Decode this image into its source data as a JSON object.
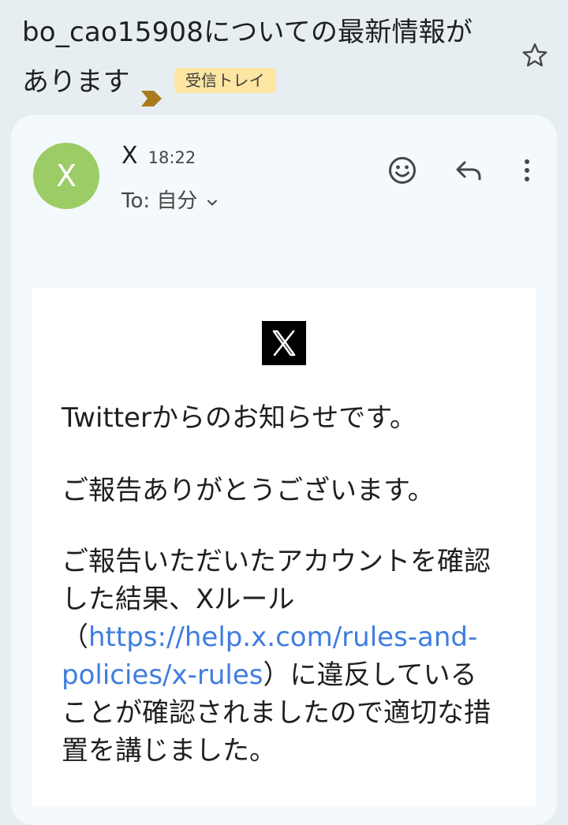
{
  "email": {
    "subject": "bo_cao15908についての最新情報があります",
    "label": "受信トレイ",
    "sender": {
      "avatar_letter": "X",
      "name": "X",
      "time": "18:22",
      "recipient": "To: 自分"
    },
    "body": {
      "greeting": "Twitterからのお知らせです。",
      "thanks": "ご報告ありがとうございます。",
      "result_part1": "ご報告いただいたアカウントを確認した結果、Xルール（",
      "result_link": "https://help.x.com/rules-and-policies/x-rules",
      "result_part2": "）に違反していることが確認されましたので適切な措置を講じました。"
    }
  },
  "icons": {
    "importance": "importance-marker-icon",
    "star": "star-icon",
    "emoji": "add-reaction-icon",
    "reply": "reply-icon",
    "more": "more-vert-icon",
    "chevron": "chevron-down-icon",
    "logo": "x-logo-icon"
  },
  "colors": {
    "background": "#e6eef2",
    "card": "#f3f9fc",
    "avatar": "#9ccc65",
    "label_bg": "#fde6a3",
    "importance": "#a97b1b",
    "link": "#3f7de0"
  }
}
